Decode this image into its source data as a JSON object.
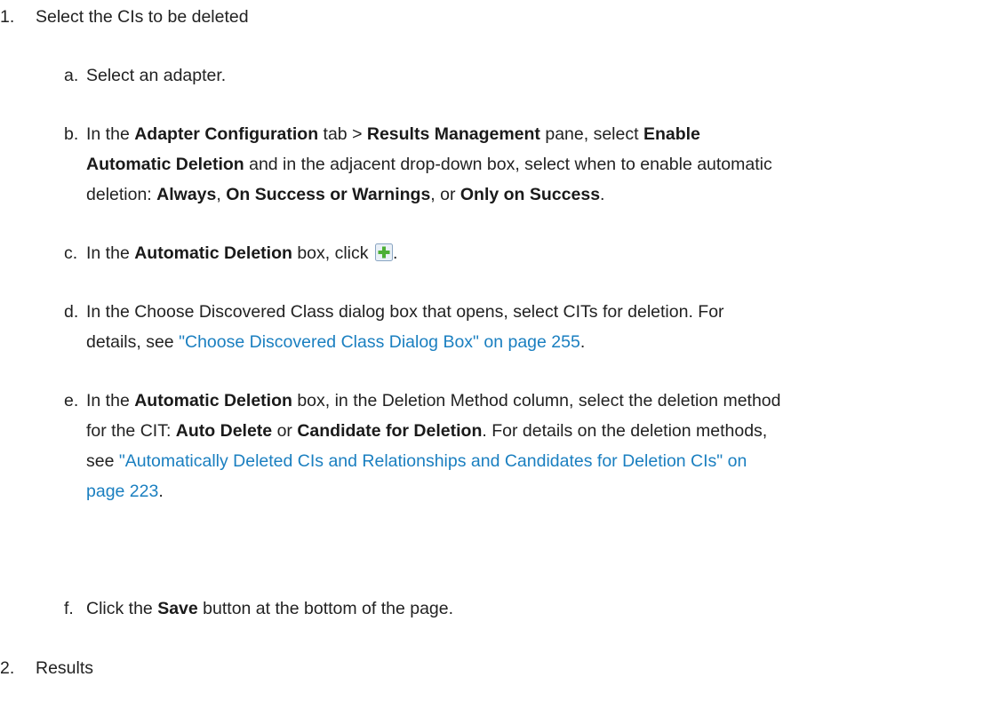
{
  "step1": {
    "number": "1.",
    "text": "Select the CIs to be deleted"
  },
  "step1_substeps": {
    "a": {
      "letter": "a.",
      "text": "Select an adapter."
    },
    "b": {
      "letter": "b.",
      "t1": "In the ",
      "b1": "Adapter Configuration",
      "t2": " tab > ",
      "b2": "Results Management",
      "t3": " pane, select ",
      "b3": "Enable",
      "b4": "Automatic Deletion",
      "t4": " and in the adjacent drop-down box, select when to enable automatic",
      "t5": "deletion: ",
      "b5": "Always",
      "t6": ", ",
      "b6": "On Success or Warnings",
      "t7": ", or ",
      "b7": "Only on Success",
      "t8": "."
    },
    "c": {
      "letter": "c.",
      "t1": "In the ",
      "b1": "Automatic Deletion",
      "t2": " box, click ",
      "t3": ".",
      "icon": "add-plus-icon",
      "icon_color": "#4caf35"
    },
    "d": {
      "letter": "d.",
      "t1": "In the Choose Discovered Class dialog box that opens, select CITs for deletion. For",
      "t2": "details, see ",
      "link": "\"Choose Discovered Class Dialog Box\" on page 255",
      "t3": "."
    },
    "e": {
      "letter": "e.",
      "t1": "In the ",
      "b1": "Automatic Deletion",
      "t2": " box, in the Deletion Method column, select the deletion method",
      "t3": "for the CIT: ",
      "b2": "Auto Delete",
      "t4": " or ",
      "b3": "Candidate for Deletion",
      "t5": ". For details on the deletion methods,",
      "t6": "see ",
      "link1": "\"Automatically Deleted CIs and Relationships and Candidates for Deletion CIs\" on",
      "link2": "page 223",
      "t7": "."
    },
    "f": {
      "letter": "f.",
      "t1": "Click the ",
      "b1": "Save",
      "t2": " button at the bottom of the page."
    }
  },
  "step2": {
    "number": "2.",
    "text": "Results"
  },
  "colors": {
    "text": "#222222",
    "link": "#1a7fc0"
  }
}
